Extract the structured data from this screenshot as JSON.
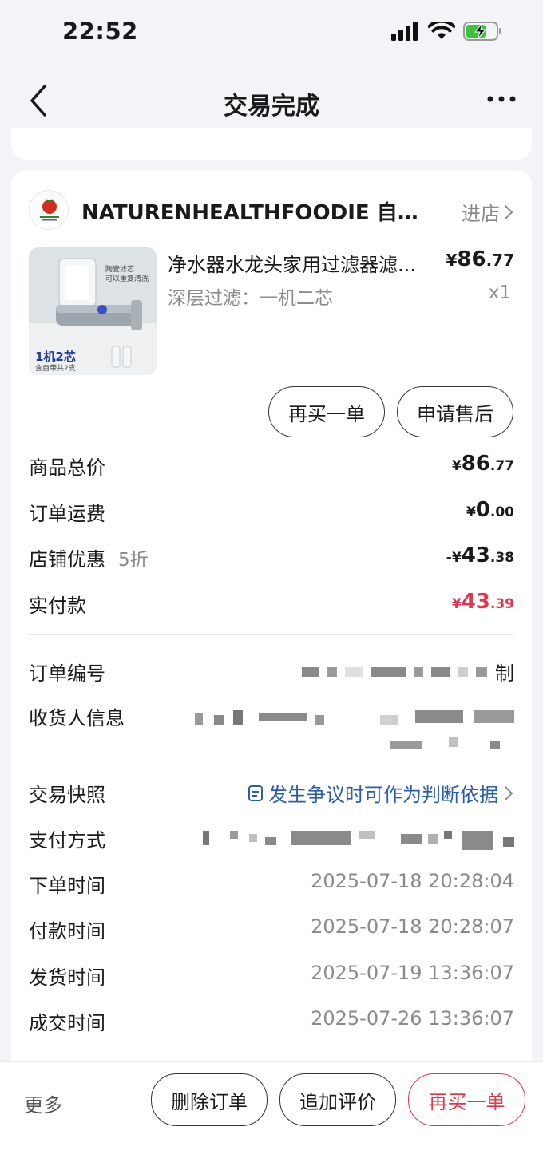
{
  "status_bar": {
    "time": "22:52"
  },
  "nav": {
    "title": "交易完成"
  },
  "shop": {
    "name": "NATURENHEALTHFOODIE 自然...",
    "enter_label": "进店"
  },
  "product": {
    "title": "净水器水龙头家用过滤器滤...",
    "price_symbol": "¥",
    "price_int": "86",
    "price_dec": ".77",
    "spec": "深层过滤：一机二芯",
    "qty": "x1",
    "image_badge": "1机2芯",
    "image_badge_sub": "含自带共2支",
    "image_caption": "陶瓷滤芯\n可以重复清洗"
  },
  "card_buttons": {
    "rebuy": "再买一单",
    "after_sale": "申请售后"
  },
  "prices": {
    "total_label": "商品总价",
    "total_symbol": "¥",
    "total_int": "86",
    "total_dec": ".77",
    "shipping_label": "订单运费",
    "shipping_symbol": "¥",
    "shipping_int": "0",
    "shipping_dec": ".00",
    "discount_label": "店铺优惠",
    "discount_note": "5折",
    "discount_symbol": "-¥",
    "discount_int": "43",
    "discount_dec": ".38",
    "paid_label": "实付款",
    "paid_symbol": "¥",
    "paid_int": "43",
    "paid_dec": ".39"
  },
  "info": {
    "order_no_label": "订单编号",
    "order_no_tail": "制",
    "receiver_label": "收货人信息",
    "snapshot_label": "交易快照",
    "snapshot_value": "发生争议时可作为判断依据",
    "payment_label": "支付方式",
    "order_time_label": "下单时间",
    "order_time": "2025-07-18 20:28:04",
    "pay_time_label": "付款时间",
    "pay_time": "2025-07-18 20:28:07",
    "ship_time_label": "发货时间",
    "ship_time": "2025-07-19 13:36:07",
    "deal_time_label": "成交时间",
    "deal_time": "2025-07-26 13:36:07"
  },
  "bottom": {
    "more": "更多",
    "delete": "删除订单",
    "review": "追加评价",
    "rebuy": "再买一单"
  },
  "colors": {
    "accent_red": "#e8334a",
    "link_blue": "#2a5dab"
  }
}
